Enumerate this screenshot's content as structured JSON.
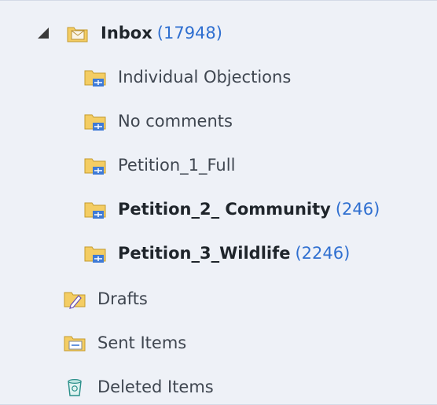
{
  "folders": {
    "inbox": {
      "label": "Inbox",
      "count": "(17948)"
    },
    "children": [
      {
        "label": "Individual Objections",
        "count": ""
      },
      {
        "label": "No comments",
        "count": ""
      },
      {
        "label": "Petition_1_Full",
        "count": ""
      },
      {
        "label": "Petition_2_ Community",
        "count": "(246)"
      },
      {
        "label": "Petition_3_Wildlife",
        "count": "(2246)"
      }
    ],
    "drafts": {
      "label": "Drafts"
    },
    "sent": {
      "label": "Sent Items"
    },
    "deleted": {
      "label": "Deleted Items"
    }
  }
}
